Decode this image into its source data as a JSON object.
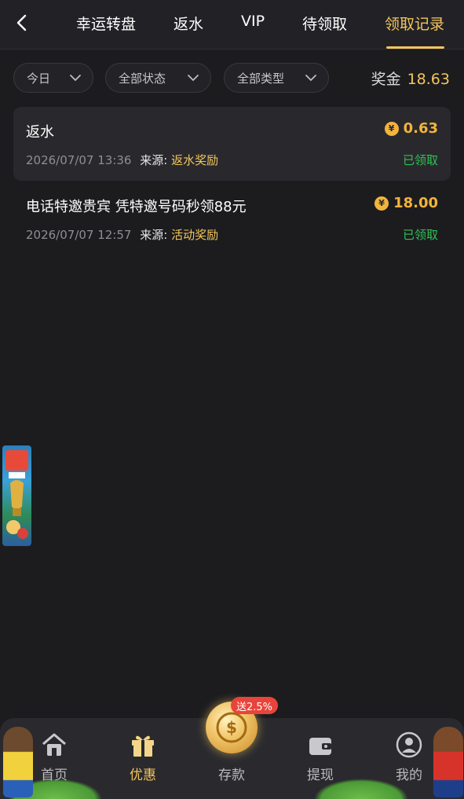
{
  "header": {
    "tabs": [
      {
        "label": "幸运转盘"
      },
      {
        "label": "返水"
      },
      {
        "label": "VIP"
      },
      {
        "label": "待领取"
      },
      {
        "label": "领取记录",
        "active": true
      }
    ]
  },
  "filters": {
    "date": "今日",
    "status": "全部状态",
    "type": "全部类型"
  },
  "bonus": {
    "label": "奖金",
    "value": "18.63"
  },
  "records": [
    {
      "title": "返水",
      "amount": "0.63",
      "time": "2026/07/07 13:36",
      "source_label": "来源:",
      "source": "返水奖励",
      "status": "已领取"
    },
    {
      "title": "电话特邀贵宾 凭特邀号码秒领88元",
      "amount": "18.00",
      "time": "2026/07/07 12:57",
      "source_label": "来源:",
      "source": "活动奖励",
      "status": "已领取"
    }
  ],
  "bottom_nav": {
    "items": [
      {
        "label": "首页",
        "icon": "home-icon"
      },
      {
        "label": "优惠",
        "icon": "gift-icon",
        "active": true
      },
      {
        "label": "存款",
        "icon": "deposit-coin-icon"
      },
      {
        "label": "提现",
        "icon": "wallet-icon"
      },
      {
        "label": "我的",
        "icon": "user-icon"
      }
    ],
    "deposit_badge": "送2.5%"
  },
  "colors": {
    "background": "#1c1c1f",
    "accent": "#f4c55c",
    "amount": "#f4b33c",
    "status_ok": "#2fc255"
  },
  "coin_symbol": "¥"
}
